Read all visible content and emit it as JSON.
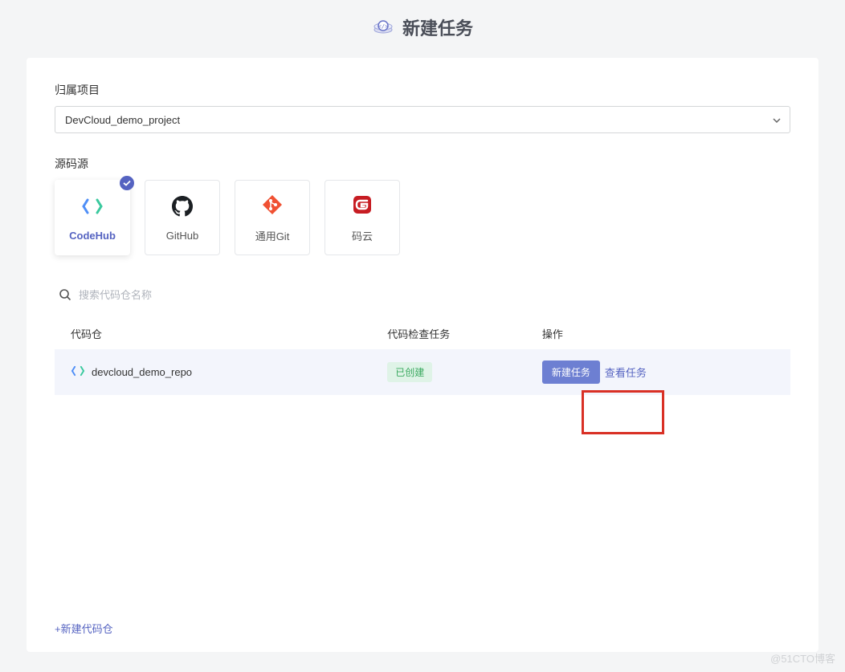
{
  "header": {
    "title": "新建任务"
  },
  "form": {
    "project_label": "归属项目",
    "project_value": "DevCloud_demo_project",
    "source_label": "源码源"
  },
  "sources": [
    {
      "id": "codehub",
      "label": "CodeHub",
      "selected": true
    },
    {
      "id": "github",
      "label": "GitHub",
      "selected": false
    },
    {
      "id": "git",
      "label": "通用Git",
      "selected": false
    },
    {
      "id": "gitee",
      "label": "码云",
      "selected": false
    }
  ],
  "search": {
    "placeholder": "搜索代码仓名称"
  },
  "table": {
    "headers": {
      "repo": "代码仓",
      "task": "代码检查任务",
      "action": "操作"
    },
    "rows": [
      {
        "repo_name": "devcloud_demo_repo",
        "status": "已创建",
        "action_create": "新建任务",
        "action_view": "查看任务"
      }
    ]
  },
  "footer": {
    "create_repo": "+新建代码仓"
  },
  "watermark": "@51CTO博客"
}
